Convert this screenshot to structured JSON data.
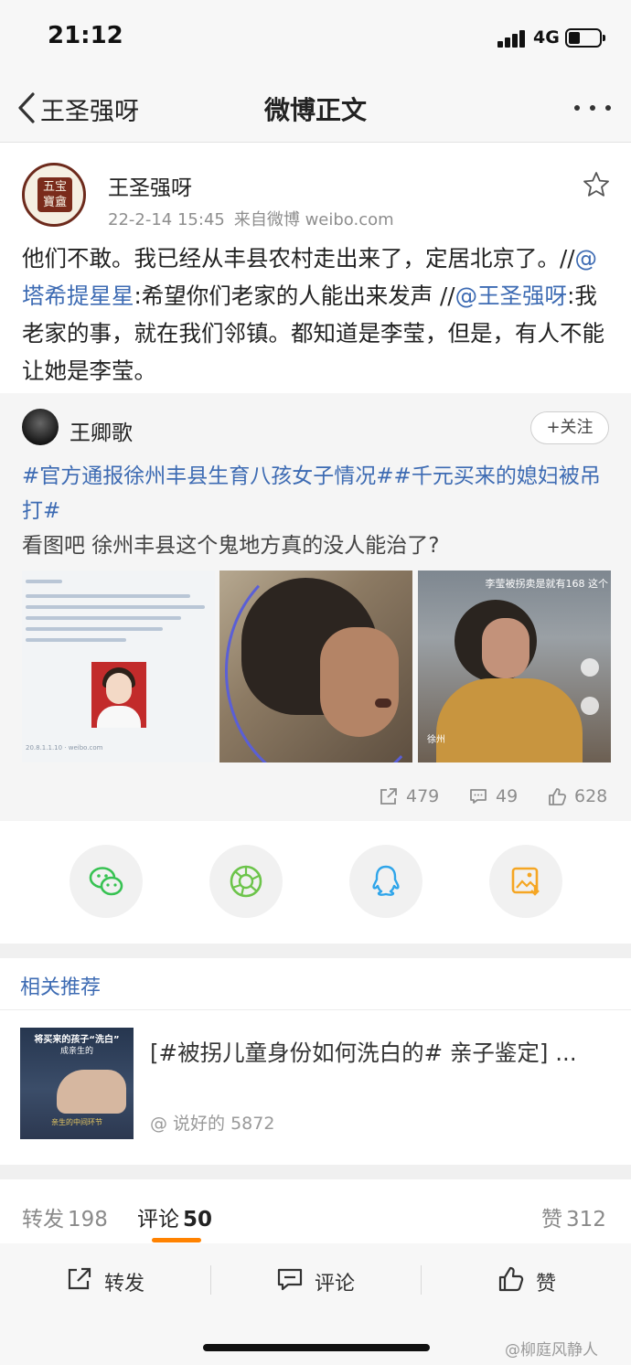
{
  "status_bar": {
    "time": "21:12",
    "network": "4G"
  },
  "nav": {
    "back_label": "王圣强呀",
    "title": "微博正文"
  },
  "post": {
    "author": "王圣强呀",
    "avatar_text": "五宝 寶盦",
    "date": "22-2-14 15:45",
    "source": "来自微博 weibo.com",
    "body_1": "他们不敢。我已经从丰县农村走出来了，定居北京了。//",
    "mention_1": "@塔希提星星",
    "body_2": ":希望你们老家的人能出来发声 //",
    "mention_2": "@王圣强呀",
    "body_3": ":我老家的事，就在我们邻镇。都知道是李莹，但是，有人不能让她是李莹。"
  },
  "repost": {
    "author": "王卿歌",
    "follow_label": "+关注",
    "tags": "#官方通报徐州丰县生育八孩女子情况##千元买来的媳妇被吊打#",
    "text": "看图吧 徐州丰县这个鬼地方真的没人能治了?",
    "image3_caption": "李莹被拐卖是就有168 这个",
    "image3_location": "徐州",
    "stats": {
      "reposts": "479",
      "comments": "49",
      "likes": "628"
    }
  },
  "share": [
    "wechat-icon",
    "moments-icon",
    "qq-icon",
    "save-image-icon"
  ],
  "colors": {
    "link": "#3d6bb3",
    "accent": "#ff8200",
    "wechat": "#37c252",
    "moments": "#6cc44a",
    "qq": "#2fa5ea",
    "save": "#f5a623"
  },
  "related": {
    "header": "相关推荐",
    "thumb_title": "将买来的孩子“洗白”",
    "thumb_sub": "成亲生的",
    "thumb_bottom": "亲生的中间环节",
    "title": "[#被拐儿童身份如何洗白的# 亲子鉴定] ...",
    "source": "@ 说好的 5872"
  },
  "tabs": [
    {
      "label": "转发",
      "count": "198"
    },
    {
      "label": "评论",
      "count": "50"
    },
    {
      "label": "赞",
      "count": "312"
    }
  ],
  "toolbar": {
    "repost": "转发",
    "comment": "评论",
    "like": "赞"
  },
  "watermark": "@柳庭风静人"
}
